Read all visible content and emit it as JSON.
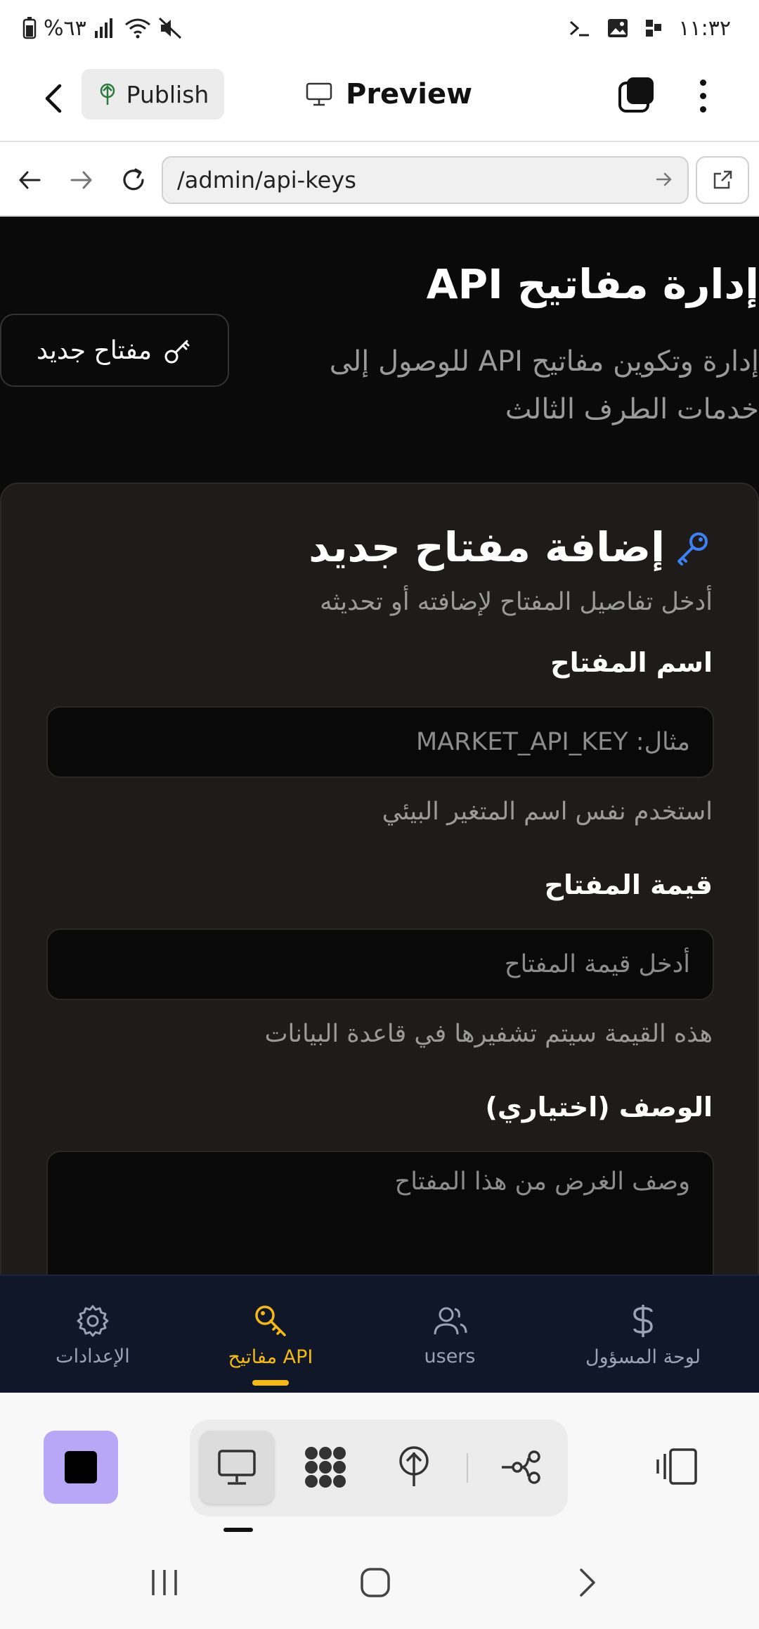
{
  "status_bar": {
    "time": "١١:٣٢",
    "battery": "%٦٣"
  },
  "app_bar": {
    "publish_label": "Publish",
    "preview_label": "Preview"
  },
  "url_bar": {
    "url": "/admin/api-keys"
  },
  "page": {
    "heading": "إدارة مفاتيح API",
    "subtitle": "إدارة وتكوين مفاتيح API للوصول إلى خدمات الطرف الثالث",
    "new_key_button": "مفتاح جديد"
  },
  "form": {
    "title": "إضافة مفتاح جديد",
    "subtitle": "أدخل تفاصيل المفتاح لإضافته أو تحديثه",
    "fields": [
      {
        "label": "اسم المفتاح",
        "placeholder": "مثال: MARKET_API_KEY",
        "hint": "استخدم نفس اسم المتغير البيئي"
      },
      {
        "label": "قيمة المفتاح",
        "placeholder": "أدخل قيمة المفتاح",
        "hint": "هذه القيمة سيتم تشفيرها في قاعدة البيانات"
      },
      {
        "label": "الوصف (اختياري)",
        "placeholder": "وصف الغرض من هذا المفتاح"
      }
    ]
  },
  "bottom_nav": {
    "items": [
      {
        "label": "الإعدادات",
        "icon": "gear-icon",
        "active": false
      },
      {
        "label": "مفاتيح API",
        "icon": "key-icon",
        "active": true
      },
      {
        "label": "users",
        "icon": "users-icon",
        "active": false
      },
      {
        "label": "لوحة المسؤول",
        "icon": "dollar-icon",
        "active": false
      }
    ]
  },
  "colors": {
    "accent": "#f5b915",
    "page_background": "#0b0a0a",
    "card_background": "#1e1b1a",
    "nav_background": "#0f1728",
    "stop_button": "#b8a7f7",
    "key_icon": "#3b82f6"
  }
}
